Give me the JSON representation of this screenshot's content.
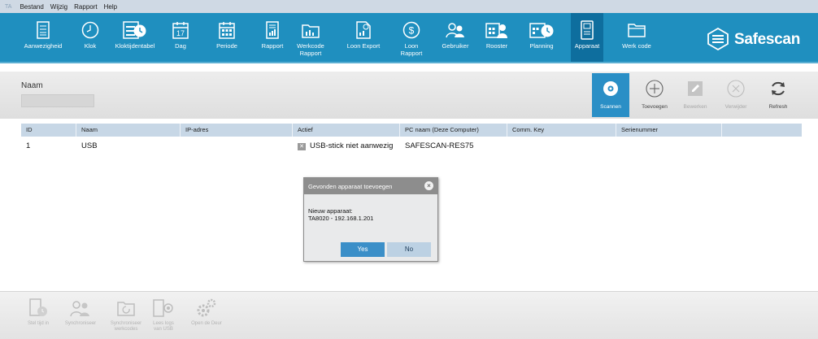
{
  "menubar": {
    "app_mark": "TA",
    "items": [
      "Bestand",
      "Wijzig",
      "Rapport",
      "Help"
    ]
  },
  "toolbar": {
    "items": [
      {
        "label": "Aanwezigheid",
        "icon": "clipboard-icon"
      },
      {
        "label": "Klok",
        "icon": "clock-icon"
      },
      {
        "label": "Kloktijdentabel",
        "icon": "clock-table-icon"
      },
      {
        "label": "Dag",
        "icon": "calendar-day-icon"
      },
      {
        "label": "Periode",
        "icon": "calendar-grid-icon"
      },
      {
        "label": "Rapport",
        "icon": "report-icon"
      },
      {
        "label": "Werkcode\nRapport",
        "icon": "workcode-report-icon"
      },
      {
        "label": "Loon Export",
        "icon": "export-icon"
      },
      {
        "label": "Loon\nRapport",
        "icon": "dollar-icon"
      },
      {
        "label": "Gebruiker",
        "icon": "user-icon"
      },
      {
        "label": "Rooster",
        "icon": "schedule-icon"
      },
      {
        "label": "Planning",
        "icon": "planning-icon"
      },
      {
        "label": "Apparaat",
        "icon": "device-icon"
      },
      {
        "label": "Werk code",
        "icon": "folder-icon"
      }
    ],
    "active": "Apparaat",
    "brand": "Safescan",
    "accent": "#1f8fbf"
  },
  "filter": {
    "label": "Naam",
    "value": ""
  },
  "actions": [
    {
      "label": "Scannen",
      "icon": "eye-icon",
      "state": "primary"
    },
    {
      "label": "Toevoegen",
      "icon": "plus-circle-icon",
      "state": "normal"
    },
    {
      "label": "Bewerken",
      "icon": "pencil-icon",
      "state": "disabled"
    },
    {
      "label": "Verwijder",
      "icon": "x-circle-icon",
      "state": "disabled"
    },
    {
      "label": "Refresh",
      "icon": "refresh-icon",
      "state": "normal"
    }
  ],
  "table": {
    "columns": [
      "ID",
      "Naam",
      "IP-adres",
      "Actief",
      "PC naam (Deze Computer)",
      "Comm. Key",
      "Serienummer"
    ],
    "rows": [
      {
        "id": "1",
        "naam": "USB",
        "ip": "",
        "actief": "USB-stick niet aanwezig",
        "pc": "SAFESCAN-RES75",
        "comm": "",
        "serial": ""
      }
    ]
  },
  "dialog": {
    "title": "Gevonden apparaat toevoegen",
    "line1": "Nieuw apparaat:",
    "line2": "TA8020 - 192.168.1.201",
    "yes": "Yes",
    "no": "No"
  },
  "footer": {
    "items": [
      {
        "label": "Stel tijd in",
        "icon": "set-time-icon"
      },
      {
        "label": "Synchroniseer",
        "icon": "sync-users-icon"
      },
      {
        "label": "Synchroniseer\nwerkcodes",
        "icon": "sync-workcodes-icon"
      },
      {
        "label": "Lees logs\nvan USB",
        "icon": "read-usb-icon"
      },
      {
        "label": "Open de Deur",
        "icon": "gears-icon"
      }
    ]
  }
}
